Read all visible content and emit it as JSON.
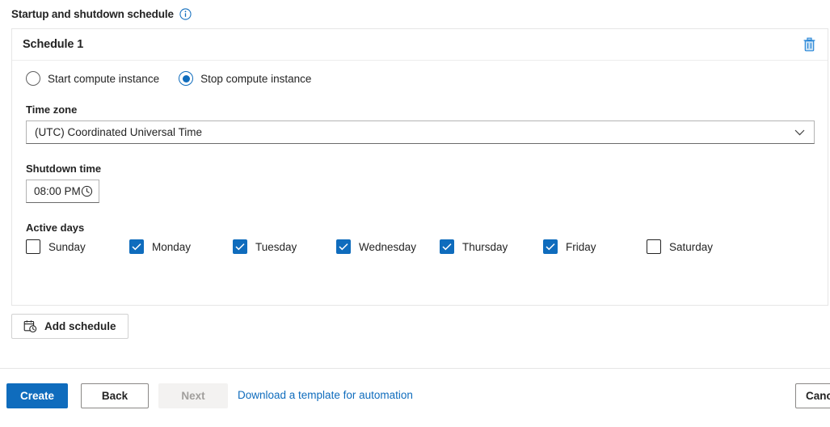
{
  "section": {
    "heading": "Startup and shutdown schedule",
    "info_icon": "info-circle-icon"
  },
  "card": {
    "title": "Schedule 1",
    "delete_icon": "trash-icon",
    "action_options": [
      {
        "label": "Start compute instance",
        "selected": false
      },
      {
        "label": "Stop compute instance",
        "selected": true
      }
    ],
    "timezone": {
      "label": "Time zone",
      "value": "(UTC) Coordinated Universal Time",
      "chevron_icon": "chevron-down-icon"
    },
    "shutdown_time": {
      "label": "Shutdown time",
      "value": "08:00 PM",
      "clock_icon": "clock-icon"
    },
    "active_days": {
      "label": "Active days",
      "days": [
        {
          "label": "Sunday",
          "checked": false
        },
        {
          "label": "Monday",
          "checked": true
        },
        {
          "label": "Tuesday",
          "checked": true
        },
        {
          "label": "Wednesday",
          "checked": true
        },
        {
          "label": "Thursday",
          "checked": true
        },
        {
          "label": "Friday",
          "checked": true
        },
        {
          "label": "Saturday",
          "checked": false
        }
      ]
    }
  },
  "add_schedule": {
    "label": "Add schedule",
    "icon": "calendar-clock-icon"
  },
  "actions": {
    "create_label": "Create",
    "back_label": "Back",
    "next_label": "Next",
    "template_link_label": "Download a template for automation",
    "cancel_label": "Cancel"
  },
  "colors": {
    "accent": "#0f6cbd",
    "text": "#242424",
    "border": "#e6e6e6",
    "disabled_bg": "#f3f2f1",
    "disabled_text": "#a19f9d"
  }
}
